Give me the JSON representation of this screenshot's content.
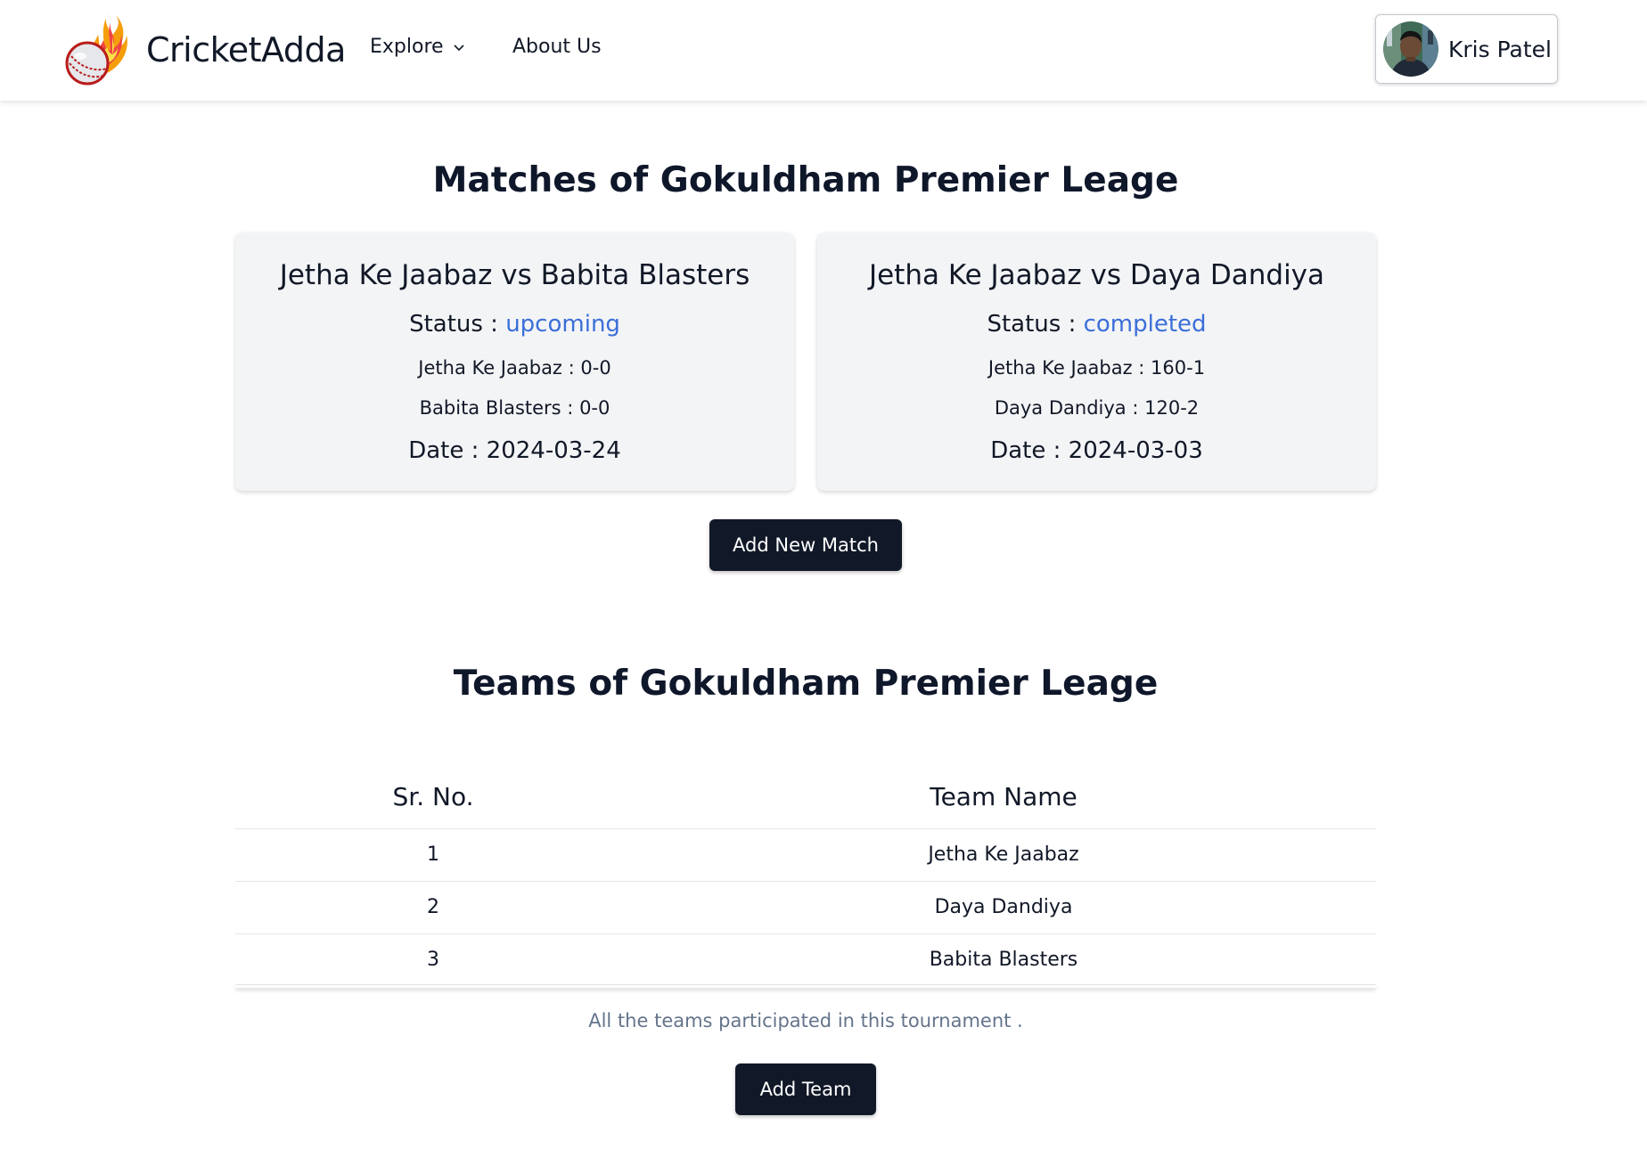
{
  "navbar": {
    "brand": "CricketAdda",
    "explore_label": "Explore",
    "about_label": "About Us",
    "user_name": "Kris Patel"
  },
  "matches": {
    "title": "Matches of Gokuldham Premier Leage",
    "status_label": "Status :",
    "date_label": "Date :",
    "cards": [
      {
        "title": "Jetha Ke Jaabaz vs Babita Blasters",
        "status": "upcoming",
        "team_a": "Jetha Ke Jaabaz",
        "score_a": "0-0",
        "team_b": "Babita Blasters",
        "score_b": "0-0",
        "date": "2024-03-24"
      },
      {
        "title": "Jetha Ke Jaabaz vs Daya Dandiya",
        "status": "completed",
        "team_a": "Jetha Ke Jaabaz",
        "score_a": "160-1",
        "team_b": "Daya Dandiya",
        "score_b": "120-2",
        "date": "2024-03-03"
      }
    ],
    "add_button": "Add New Match"
  },
  "teams": {
    "title": "Teams of Gokuldham Premier Leage",
    "columns": [
      "Sr. No.",
      "Team Name"
    ],
    "rows": [
      {
        "sr": "1",
        "name": "Jetha Ke Jaabaz"
      },
      {
        "sr": "2",
        "name": "Daya Dandiya"
      },
      {
        "sr": "3",
        "name": "Babita Blasters"
      }
    ],
    "caption": "All the teams participated in this tournament .",
    "add_button": "Add Team"
  },
  "colors": {
    "status_link": "#3b6fd8",
    "button_bg": "#111827",
    "card_bg": "#f3f4f6",
    "caption": "#64748b"
  },
  "icons": {
    "logo": "flaming-cricket-ball-icon",
    "explore_chevron": "chevron-down-icon",
    "user_avatar": "avatar"
  }
}
